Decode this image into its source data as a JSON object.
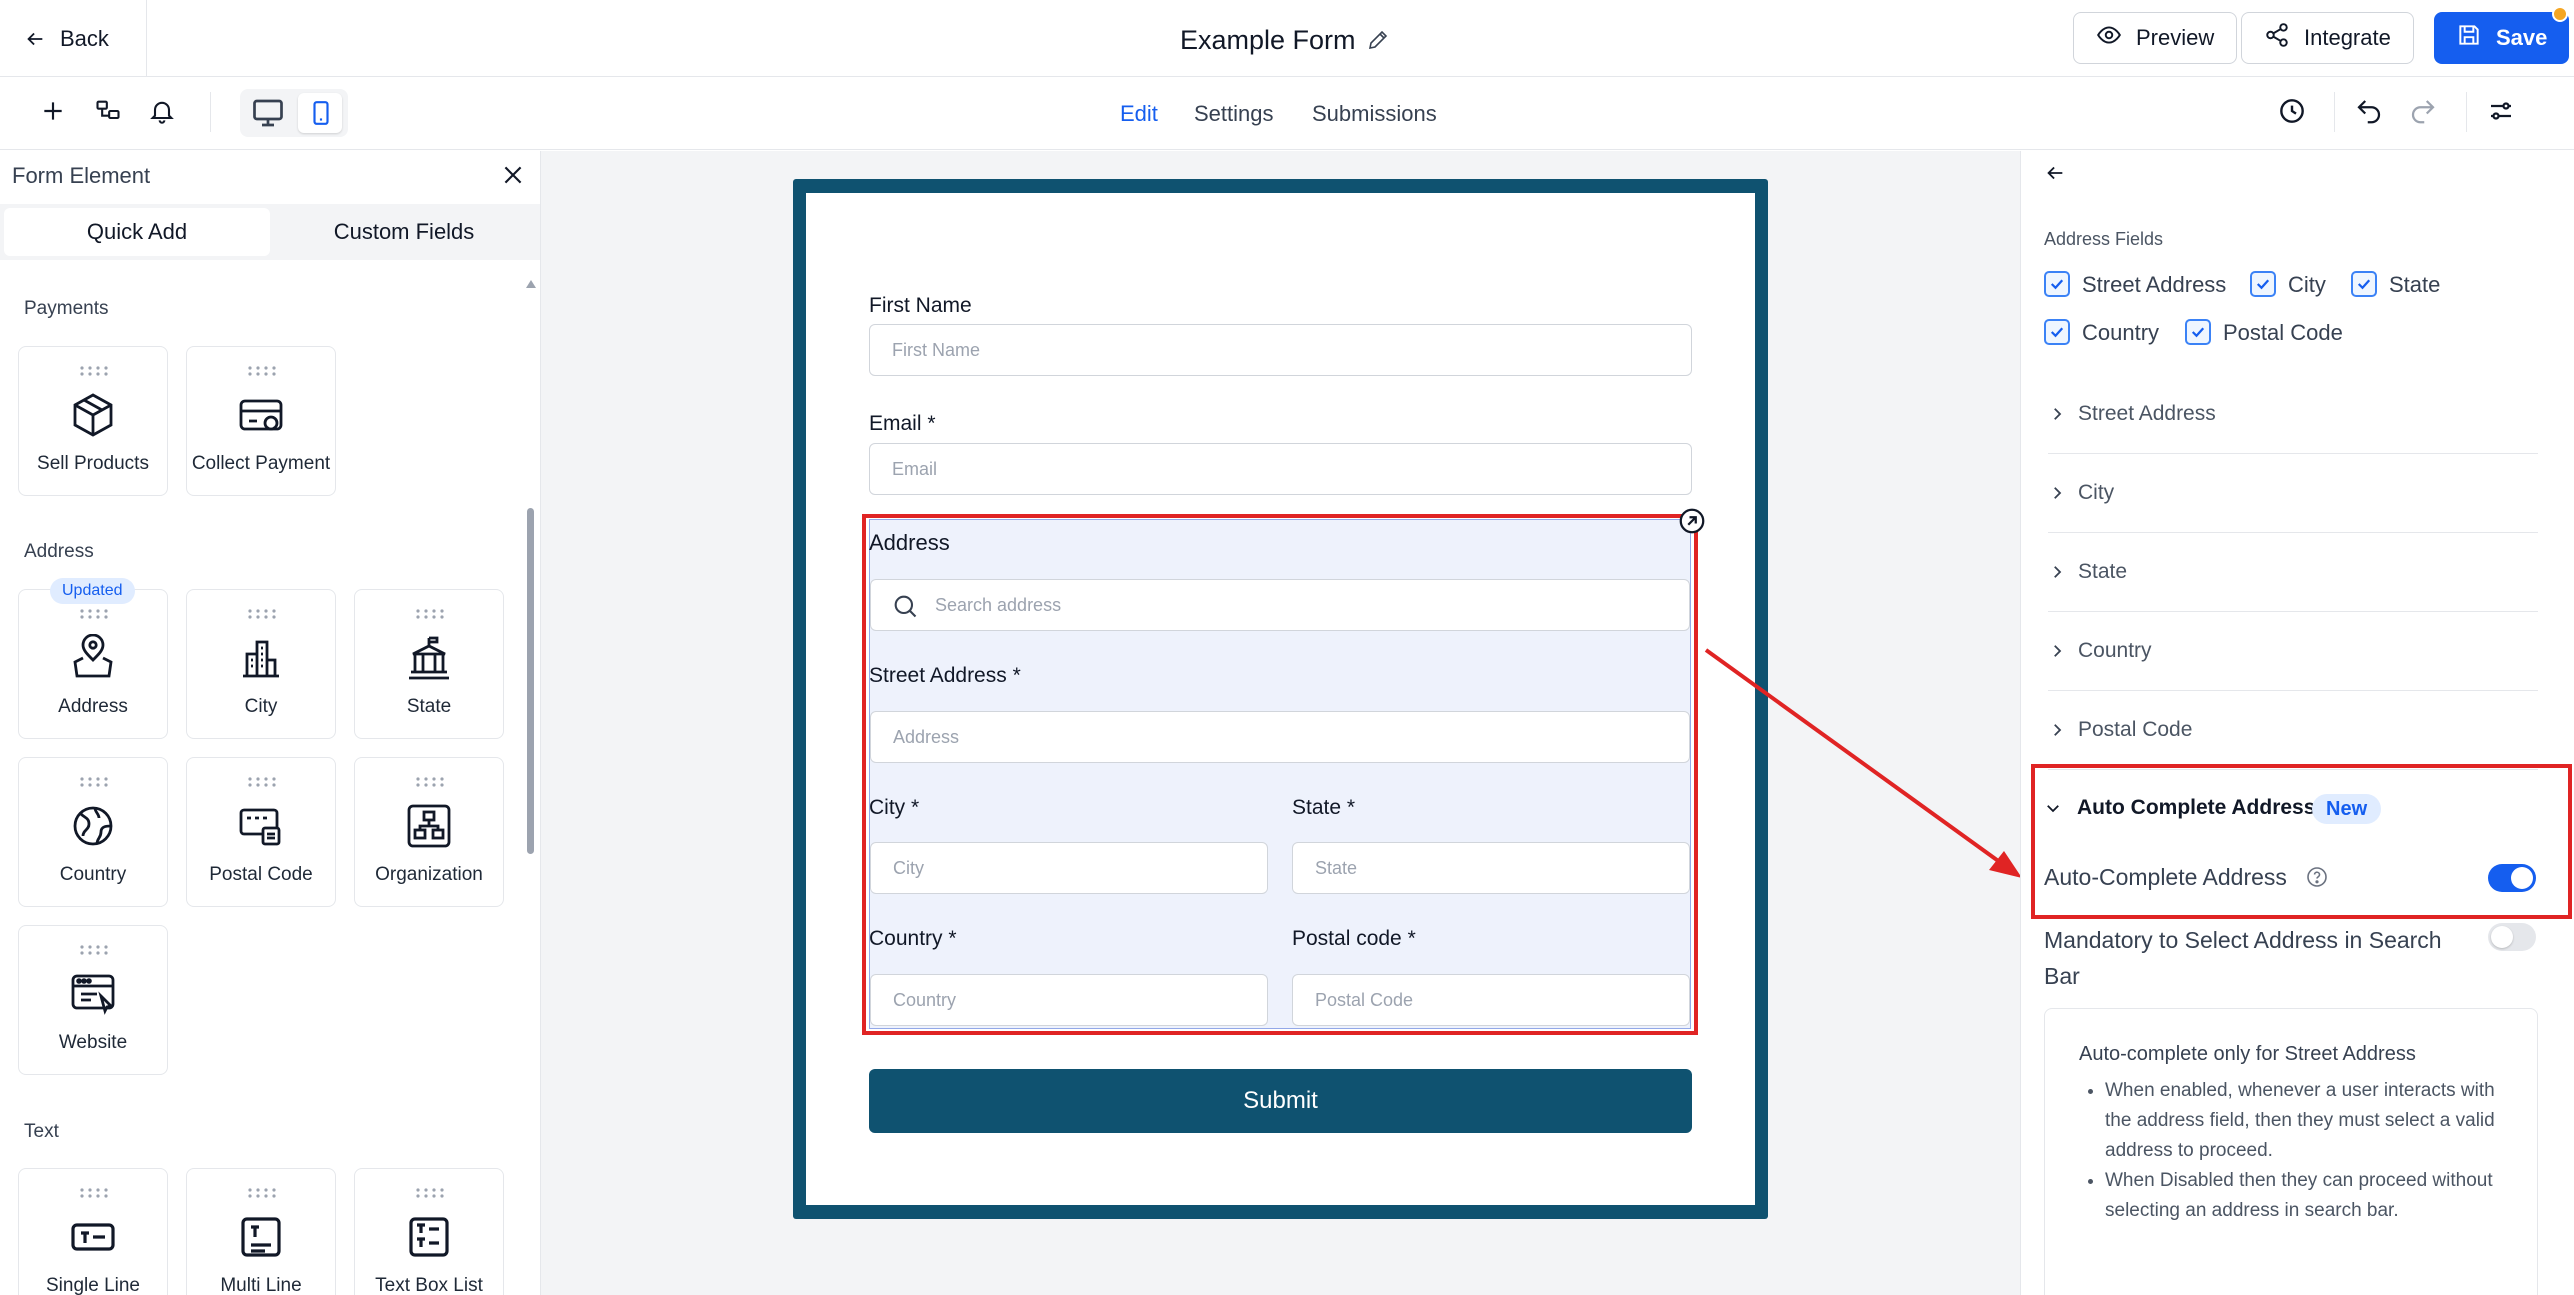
{
  "header": {
    "back_label": "Back",
    "title": "Example Form",
    "preview_label": "Preview",
    "integrate_label": "Integrate",
    "save_label": "Save"
  },
  "tabs": [
    {
      "label": "Edit",
      "active": true
    },
    {
      "label": "Settings",
      "active": false
    },
    {
      "label": "Submissions",
      "active": false
    }
  ],
  "left_panel": {
    "title": "Form Element",
    "tab_quick_add": "Quick Add",
    "tab_custom_fields": "Custom Fields",
    "sections": [
      {
        "title": "Payments",
        "items": [
          {
            "label": "Sell Products",
            "icon": "box-icon"
          },
          {
            "label": "Collect Payment",
            "icon": "card-icon"
          }
        ]
      },
      {
        "title": "Address",
        "items": [
          {
            "label": "Address",
            "icon": "map-pin-icon",
            "badge": "Updated"
          },
          {
            "label": "City",
            "icon": "city-icon"
          },
          {
            "label": "State",
            "icon": "state-building-icon"
          },
          {
            "label": "Country",
            "icon": "globe-icon"
          },
          {
            "label": "Postal Code",
            "icon": "postal-icon"
          },
          {
            "label": "Organization",
            "icon": "organization-icon"
          },
          {
            "label": "Website",
            "icon": "website-icon"
          }
        ]
      },
      {
        "title": "Text",
        "items": [
          {
            "label": "Single Line",
            "icon": "single-line-icon"
          },
          {
            "label": "Multi Line",
            "icon": "multi-line-icon"
          },
          {
            "label": "Text Box List",
            "icon": "text-box-list-icon"
          }
        ]
      }
    ]
  },
  "form": {
    "first_name_label": "First Name",
    "first_name_placeholder": "First Name",
    "email_label": "Email *",
    "email_placeholder": "Email",
    "address_label": "Address",
    "search_placeholder": "Search address",
    "street_label": "Street Address *",
    "street_placeholder": "Address",
    "city_label": "City *",
    "city_placeholder": "City",
    "state_label": "State *",
    "state_placeholder": "State",
    "country_label": "Country *",
    "country_placeholder": "Country",
    "postal_label": "Postal code *",
    "postal_placeholder": "Postal Code",
    "submit_label": "Submit"
  },
  "right_panel": {
    "address_fields_title": "Address Fields",
    "checkboxes": [
      {
        "label": "Street Address",
        "checked": true
      },
      {
        "label": "City",
        "checked": true
      },
      {
        "label": "State",
        "checked": true
      },
      {
        "label": "Country",
        "checked": true
      },
      {
        "label": "Postal Code",
        "checked": true
      }
    ],
    "accordions": [
      "Street Address",
      "City",
      "State",
      "Country",
      "Postal Code"
    ],
    "auto_complete_title": "Auto Complete Address",
    "new_badge": "New",
    "auto_complete_toggle_label": "Auto-Complete Address",
    "auto_complete_enabled": true,
    "mandatory_label": "Mandatory to Select Address in Search Bar",
    "mandatory_enabled": false,
    "info_title": "Auto-complete only for Street Address",
    "info_bullets": [
      "When enabled, whenever a user interacts with the address field, then they must select a valid address to proceed.",
      "When Disabled then they can proceed without selecting an address in search bar."
    ]
  },
  "colors": {
    "primary": "#155eef",
    "form_frame": "#0f5270",
    "highlight_red": "#e02424",
    "address_bg": "#eef2fc"
  }
}
